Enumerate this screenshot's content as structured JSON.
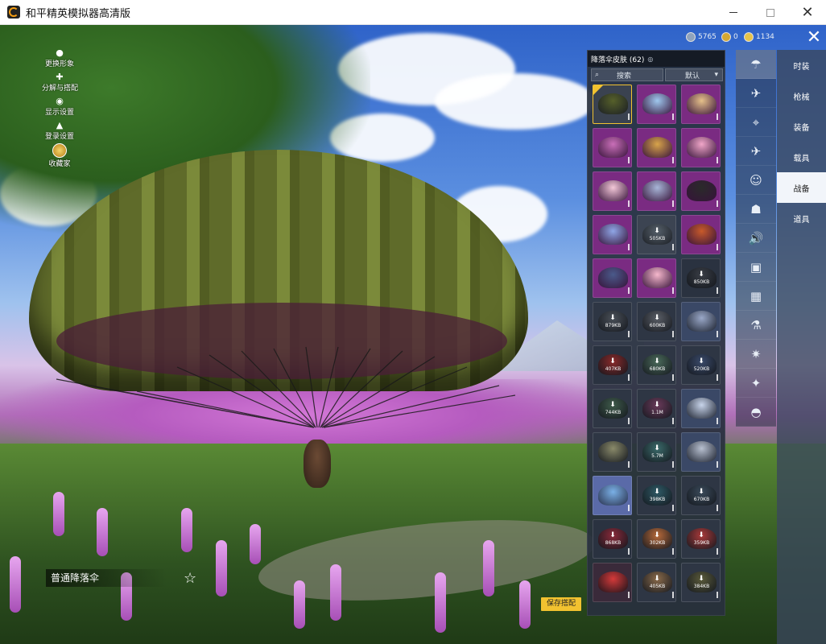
{
  "window": {
    "title": "和平精英模拟器高清版",
    "min_glyph": "",
    "close_glyph": "✕"
  },
  "left_menu": [
    {
      "label": "更换形象",
      "icon": "person-icon"
    },
    {
      "label": "分解与搭配",
      "icon": "puzzle-icon"
    },
    {
      "label": "显示设置",
      "icon": "eye-icon"
    },
    {
      "label": "登录设置",
      "icon": "home-icon"
    },
    {
      "label": "收藏家",
      "icon": "badge-icon"
    }
  ],
  "currency": [
    {
      "value": "5765",
      "color": "#8fa3bd"
    },
    {
      "value": "0",
      "color": "#d4a832"
    },
    {
      "value": "1134",
      "color": "#e6c34a"
    }
  ],
  "panel": {
    "title": "降落伞皮肤 (62)",
    "eye_glyph": "◎",
    "search_placeholder": "搜索",
    "sort_label": "默认",
    "sort_arrow": "▾",
    "search_glyph": "⌕"
  },
  "skins": [
    {
      "color": "#56602a",
      "bg": "#3a4250",
      "size": "",
      "dl": false,
      "selected": true
    },
    {
      "color": "#9fc8ee",
      "bg": "#7a2b82",
      "size": "",
      "dl": false
    },
    {
      "color": "#e6c18a",
      "bg": "#7a2b82",
      "size": "",
      "dl": false
    },
    {
      "color": "#c96fb8",
      "bg": "#7a2b82",
      "size": "",
      "dl": false
    },
    {
      "color": "#d8a44a",
      "bg": "#7a2b82",
      "size": "",
      "dl": false
    },
    {
      "color": "#f0a6c8",
      "bg": "#7a2b82",
      "size": "",
      "dl": false
    },
    {
      "color": "#f3c8d8",
      "bg": "#7a2b82",
      "size": "",
      "dl": false
    },
    {
      "color": "#a8b6d8",
      "bg": "#7a2b82",
      "size": "",
      "dl": false
    },
    {
      "color": "#2a2a2a",
      "bg": "#7a2b82",
      "size": "",
      "dl": false
    },
    {
      "color": "#8fa6e6",
      "bg": "#7a2b82",
      "size": "",
      "dl": false
    },
    {
      "color": "#56606a",
      "bg": "#3c4452",
      "size": "505KB",
      "dl": true
    },
    {
      "color": "#c85a2a",
      "bg": "#7a2b82",
      "size": "",
      "dl": false
    },
    {
      "color": "#4a5a8a",
      "bg": "#7a2b82",
      "size": "",
      "dl": false
    },
    {
      "color": "#f6b8cc",
      "bg": "#7a2b82",
      "size": "",
      "dl": false
    },
    {
      "color": "#3a3e46",
      "bg": "#2a3240",
      "size": "850KB",
      "dl": true
    },
    {
      "color": "#4a5058",
      "bg": "#2e3644",
      "size": "879KB",
      "dl": true
    },
    {
      "color": "#5a5e66",
      "bg": "#2e3644",
      "size": "600KB",
      "dl": true
    },
    {
      "color": "#9aa8c8",
      "bg": "#3a4866",
      "size": "",
      "dl": false
    },
    {
      "color": "#8a2a2a",
      "bg": "#2a3240",
      "size": "407KB",
      "dl": true
    },
    {
      "color": "#4a6a5a",
      "bg": "#2e3644",
      "size": "680KB",
      "dl": true
    },
    {
      "color": "#3a4a6a",
      "bg": "#2e3644",
      "size": "520KB",
      "dl": true
    },
    {
      "color": "#3e5a4a",
      "bg": "#2e3644",
      "size": "744KB",
      "dl": true
    },
    {
      "color": "#6a3a5a",
      "bg": "#2e3644",
      "size": "1.1M",
      "dl": true
    },
    {
      "color": "#c8d4ea",
      "bg": "#3a4866",
      "size": "",
      "dl": false
    },
    {
      "color": "#8a8a6a",
      "bg": "#2e3644",
      "size": "",
      "dl": false
    },
    {
      "color": "#3a6a6a",
      "bg": "#2e3644",
      "size": "5.7M",
      "dl": true
    },
    {
      "color": "#b8c0d0",
      "bg": "#3a4866",
      "size": "",
      "dl": false
    },
    {
      "color": "#7ab0e6",
      "bg": "#5a6aa8",
      "size": "",
      "dl": false
    },
    {
      "color": "#2e5a66",
      "bg": "#2e3644",
      "size": "398KB",
      "dl": true
    },
    {
      "color": "#3a4a5a",
      "bg": "#2e3644",
      "size": "670KB",
      "dl": true
    },
    {
      "color": "#8a2a3a",
      "bg": "#2a3240",
      "size": "868KB",
      "dl": true
    },
    {
      "color": "#b86a3a",
      "bg": "#2e3644",
      "size": "302KB",
      "dl": true
    },
    {
      "color": "#aa3a3a",
      "bg": "#2e3644",
      "size": "359KB",
      "dl": true
    },
    {
      "color": "#d43a3a",
      "bg": "#3a2a3a",
      "size": "",
      "dl": false
    },
    {
      "color": "#8a6a4a",
      "bg": "#2e3644",
      "size": "405KB",
      "dl": true
    },
    {
      "color": "#5a5a3a",
      "bg": "#2e3644",
      "size": "384KB",
      "dl": true
    }
  ],
  "icon_tabs": [
    {
      "name": "parachute-icon",
      "glyph": "☂",
      "active": true
    },
    {
      "name": "plane-wing-icon",
      "glyph": "✈"
    },
    {
      "name": "drone-icon",
      "glyph": "⌖"
    },
    {
      "name": "plane-icon",
      "glyph": "✈"
    },
    {
      "name": "emote-icon",
      "glyph": "☺"
    },
    {
      "name": "robot-icon",
      "glyph": "☗"
    },
    {
      "name": "speaker-icon",
      "glyph": "🔊"
    },
    {
      "name": "card-icon",
      "glyph": "▣"
    },
    {
      "name": "picture-icon",
      "glyph": "▦"
    },
    {
      "name": "spray-icon",
      "glyph": "⚗"
    },
    {
      "name": "sparkle-icon",
      "glyph": "✷"
    },
    {
      "name": "wand-icon",
      "glyph": "✦"
    },
    {
      "name": "ufo-icon",
      "glyph": "◓"
    }
  ],
  "categories": [
    {
      "label": "时装"
    },
    {
      "label": "枪械"
    },
    {
      "label": "装备"
    },
    {
      "label": "载具"
    },
    {
      "label": "战备",
      "active": true
    },
    {
      "label": "道具"
    }
  ],
  "bottom": {
    "chute_name": "普通降落伞",
    "star_glyph": "☆",
    "save_label": "保存搭配"
  },
  "top_close_glyph": "✕"
}
